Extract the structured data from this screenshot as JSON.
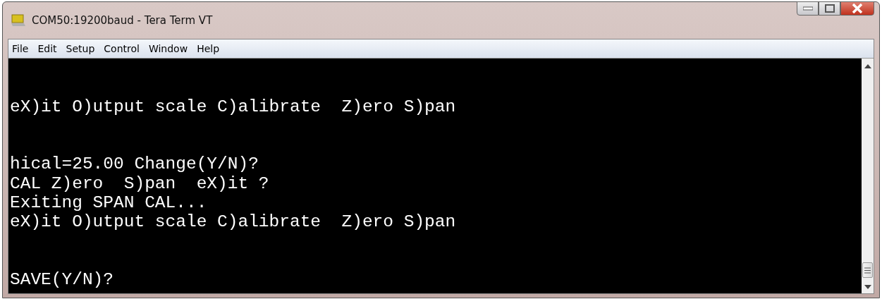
{
  "window": {
    "title": "COM50:19200baud - Tera Term VT"
  },
  "menu": [
    "File",
    "Edit",
    "Setup",
    "Control",
    "Window",
    "Help"
  ],
  "terminal": {
    "blocks": [
      [
        "eX)it O)utput scale C)alibrate  Z)ero S)pan"
      ],
      [
        "hical=25.00 Change(Y/N)?",
        "CAL Z)ero  S)pan  eX)it ?",
        "Exiting SPAN CAL...",
        "eX)it O)utput scale C)alibrate  Z)ero S)pan"
      ],
      [
        "SAVE(Y/N)?"
      ]
    ]
  }
}
